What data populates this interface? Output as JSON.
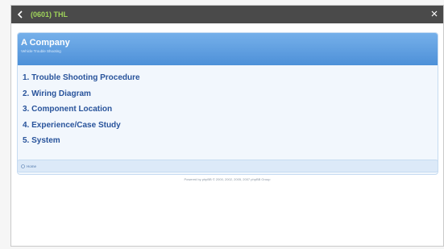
{
  "titlebar": {
    "title": "(0601) THL",
    "back_icon": "chevron-left-icon",
    "close_icon": "close-icon"
  },
  "header": {
    "company": "A Company",
    "subtitle": "Vehicle Trouble Shooting"
  },
  "menu": {
    "items": [
      {
        "label": "1. Trouble Shooting Procedure"
      },
      {
        "label": "2. Wiring Diagram"
      },
      {
        "label": "3. Component Location"
      },
      {
        "label": "4. Experience/Case Study"
      },
      {
        "label": "5. System"
      }
    ]
  },
  "nav": {
    "home_label": "Home",
    "home_icon": "home-icon"
  },
  "footer": {
    "text": "Powered by phpBB © 2000, 2002, 2005, 2007 phpBB Group"
  },
  "colors": {
    "titlebar_bg": "#4a4a4a",
    "title_text": "#9fd45a",
    "header_bg": "#4d90d8",
    "menu_text": "#28539b",
    "panel_bg": "#f2f7fd"
  }
}
